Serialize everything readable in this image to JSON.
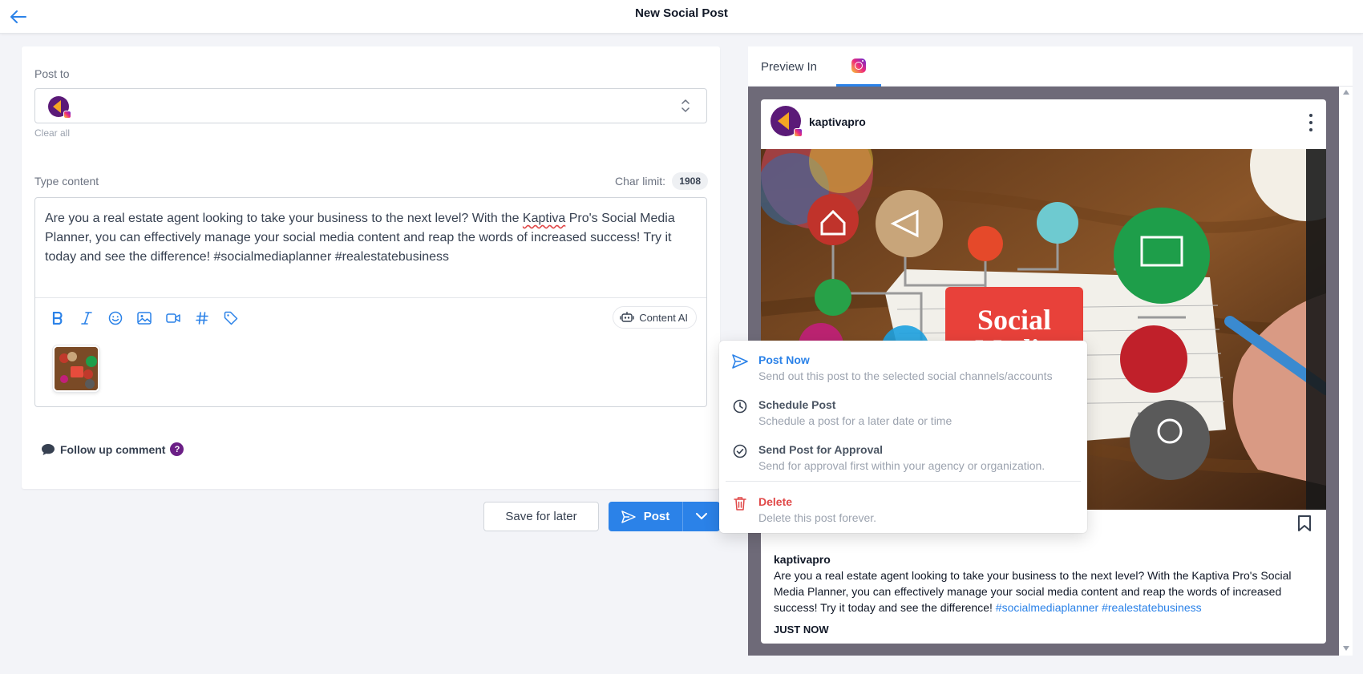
{
  "header": {
    "title": "New Social Post"
  },
  "post_to": {
    "label": "Post to",
    "clear_all": "Clear all"
  },
  "content": {
    "label": "Type content",
    "char_limit_label": "Char limit:",
    "char_limit_value": "1908",
    "text_before": "Are you a real estate agent looking to take your business to the next level? With the ",
    "text_brand": "Kaptiva",
    "text_after": " Pro's Social Media Planner, you can effectively manage your social media content and reap the words of increased success! Try it today and see the difference! #socialmediaplanner #realestatebusiness",
    "content_ai_label": "Content AI"
  },
  "follow_up": {
    "label": "Follow up comment",
    "help": "?"
  },
  "actions": {
    "save_label": "Save for later",
    "post_label": "Post"
  },
  "menu": {
    "items": [
      {
        "title": "Post Now",
        "description": "Send out this post to the selected social channels/accounts",
        "color": "#2b82e8"
      },
      {
        "title": "Schedule Post",
        "description": "Schedule a post for a later date or time",
        "color": "#4b5563"
      },
      {
        "title": "Send Post for Approval",
        "description": "Send for approval first within your agency or organization.",
        "color": "#4b5563"
      },
      {
        "title": "Delete",
        "description": "Delete this post forever.",
        "color": "#e04848"
      }
    ]
  },
  "preview": {
    "label": "Preview In",
    "platform": "instagram",
    "username": "kaptivapro",
    "image_text_1": "Social",
    "image_text_2": "Media",
    "caption_plain": "Are you a real estate agent looking to take your business to the next level? With the Kaptiva Pro's Social Media Planner, you can effectively manage your social media content and reap the words of increased success! Try it today and see the difference! ",
    "caption_tags": "#socialmediaplanner #realestatebusiness",
    "timestamp": "JUST NOW"
  },
  "colors": {
    "accent": "#2b82e8",
    "brand_purple": "#5b1a78",
    "danger": "#e04848"
  }
}
